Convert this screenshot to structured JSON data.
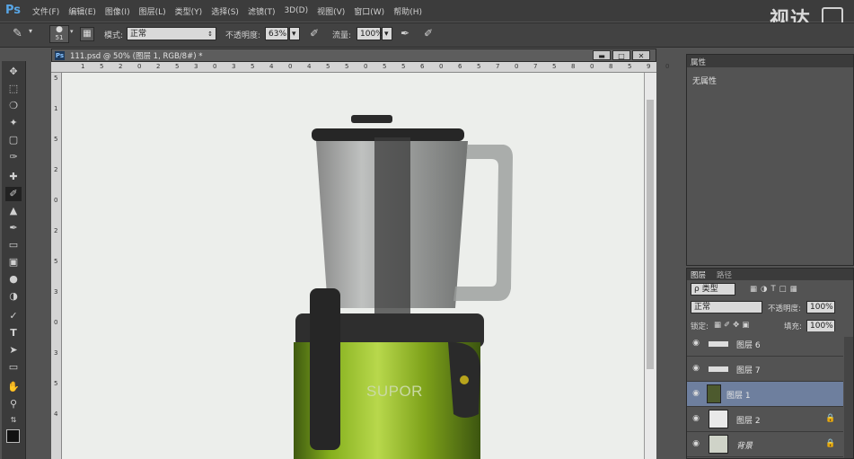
{
  "app": {
    "logo": "Ps",
    "watermark": "视达"
  },
  "menu": [
    "文件(F)",
    "编辑(E)",
    "图像(I)",
    "图层(L)",
    "类型(Y)",
    "选择(S)",
    "滤镜(T)",
    "3D(D)",
    "视图(V)",
    "窗口(W)",
    "帮助(H)"
  ],
  "options": {
    "brush_size": "51",
    "mode_label": "模式:",
    "mode_value": "正常",
    "opacity_label": "不透明度:",
    "opacity_value": "63%",
    "flow_label": "流量:",
    "flow_value": "100%"
  },
  "document": {
    "icon": "Ps",
    "title": "111.psd @ 50% (图层 1, RGB/8#) *",
    "product_text": "SUPOR",
    "ruler_top": [
      "1",
      "5",
      "2",
      "0",
      "2",
      "5",
      "3",
      "0",
      "3",
      "5",
      "4",
      "0",
      "4",
      "5",
      "5",
      "0",
      "5",
      "5",
      "6",
      "0",
      "6",
      "5",
      "7",
      "0",
      "7",
      "5",
      "8",
      "0",
      "8",
      "5",
      "9",
      "0"
    ],
    "ruler_left": [
      "5",
      "1",
      "5",
      "2",
      "0",
      "2",
      "5",
      "3",
      "0",
      "3",
      "5",
      "4"
    ]
  },
  "properties": {
    "tab": "属性",
    "no_properties": "无属性"
  },
  "layers": {
    "tab_layers": "图层",
    "tab_paths": "路径",
    "filter_kind": "ρ 类型",
    "blend_mode": "正常",
    "opacity_label": "不透明度:",
    "opacity_value": "100%",
    "lock_label": "锁定:",
    "fill_label": "填充:",
    "fill_value": "100%",
    "items": [
      {
        "name": "图层 6",
        "locked": false,
        "selected": false
      },
      {
        "name": "图层 7",
        "locked": false,
        "selected": false
      },
      {
        "name": "图层 1",
        "locked": false,
        "selected": true
      },
      {
        "name": "图层 2",
        "locked": true,
        "selected": false
      },
      {
        "name": "背景",
        "locked": true,
        "selected": false
      }
    ]
  }
}
